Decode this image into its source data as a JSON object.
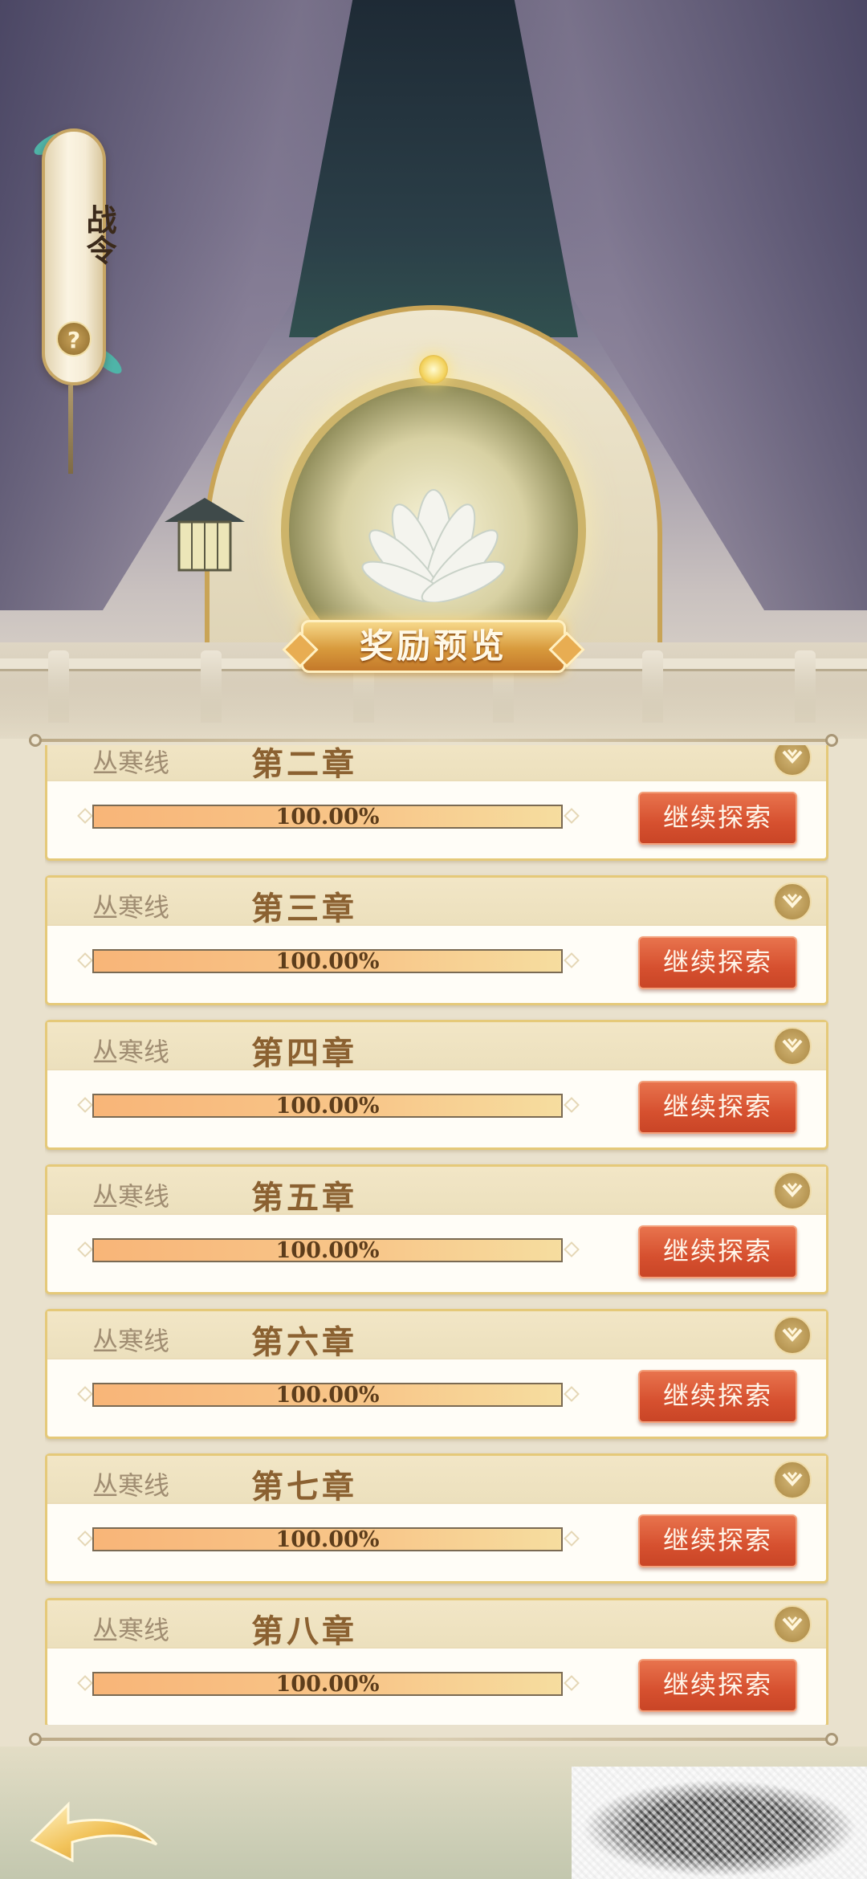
{
  "header": {
    "banner_title": "战令",
    "help_label": "?",
    "reward_preview_label": "奖励预览"
  },
  "chapters": [
    {
      "line": "丛寒线",
      "title": "第二章",
      "progress": 1.0,
      "progress_text": "100.00%",
      "action_label": "继续探索"
    },
    {
      "line": "丛寒线",
      "title": "第三章",
      "progress": 1.0,
      "progress_text": "100.00%",
      "action_label": "继续探索"
    },
    {
      "line": "丛寒线",
      "title": "第四章",
      "progress": 1.0,
      "progress_text": "100.00%",
      "action_label": "继续探索"
    },
    {
      "line": "丛寒线",
      "title": "第五章",
      "progress": 1.0,
      "progress_text": "100.00%",
      "action_label": "继续探索"
    },
    {
      "line": "丛寒线",
      "title": "第六章",
      "progress": 1.0,
      "progress_text": "100.00%",
      "action_label": "继续探索"
    },
    {
      "line": "丛寒线",
      "title": "第七章",
      "progress": 1.0,
      "progress_text": "100.00%",
      "action_label": "继续探索"
    },
    {
      "line": "丛寒线",
      "title": "第八章",
      "progress": 1.0,
      "progress_text": "100.00%",
      "action_label": "继续探索"
    }
  ],
  "icons": {
    "expand": "chevron-down-icon",
    "back": "back-arrow-icon",
    "help": "question-icon"
  },
  "colors": {
    "accent_gold": "#c9a456",
    "button_red": "#d6502f",
    "progress_orange": "#f8b578",
    "chapter_text": "#8b6131"
  }
}
